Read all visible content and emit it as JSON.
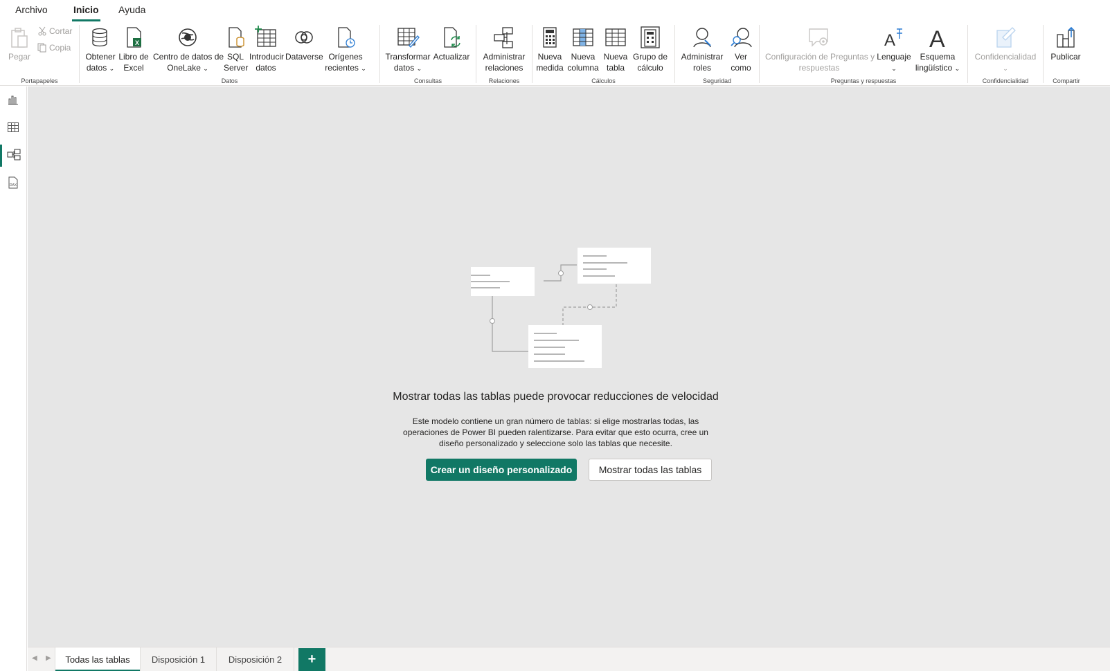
{
  "menu": {
    "tabs": [
      "Archivo",
      "Inicio",
      "Ayuda"
    ],
    "active": "Inicio"
  },
  "ribbon": {
    "clipboard": {
      "paste": "Pegar",
      "cut": "Cortar",
      "copy": "Copia",
      "label": "Portapapeles"
    },
    "data": {
      "label": "Datos",
      "get_data": "Obtener",
      "get_data2": "datos",
      "excel": "Libro de",
      "excel2": "Excel",
      "onelake": "Centro de datos de",
      "onelake2": "OneLake",
      "sql": "SQL",
      "sql2": "Server",
      "enter": "Introducir",
      "enter2": "datos",
      "dataverse": "Dataverse",
      "recent": "Orígenes",
      "recent2": "recientes"
    },
    "queries": {
      "label": "Consultas",
      "transform": "Transformar",
      "transform2": "datos",
      "refresh": "Actualizar"
    },
    "relations": {
      "label": "Relaciones",
      "manage": "Administrar",
      "manage2": "relaciones"
    },
    "calcs": {
      "label": "Cálculos",
      "measure": "Nueva",
      "measure2": "medida",
      "column": "Nueva",
      "column2": "columna",
      "table": "Nueva",
      "table2": "tabla",
      "group": "Grupo de",
      "group2": "cálculo"
    },
    "security": {
      "label": "Seguridad",
      "roles": "Administrar",
      "roles2": "roles",
      "view": "Ver",
      "view2": "como"
    },
    "qa": {
      "label": "Preguntas y respuestas",
      "setup": "Configuración de Preguntas y",
      "setup2": "respuestas",
      "language": "Lenguaje",
      "schema": "Esquema",
      "schema2": "lingüístico"
    },
    "sensitivity": {
      "label": "Confidencialidad",
      "btn": "Confidencialidad"
    },
    "share": {
      "label": "Compartir",
      "publish": "Publicar"
    }
  },
  "canvas": {
    "title": "Mostrar todas las tablas puede provocar reducciones de velocidad",
    "body": "Este modelo contiene un gran número de tablas: si elige mostrarlas todas, las operaciones de Power BI pueden ralentizarse. Para evitar que esto ocurra, cree un diseño personalizado y seleccione solo las tablas que necesite.",
    "primary_button": "Crear un diseño personalizado",
    "secondary_button": "Mostrar todas las tablas"
  },
  "bottom_tabs": [
    "Todas las tablas",
    "Disposición 1",
    "Disposición 2"
  ],
  "add_tab": "+",
  "colors": {
    "accent": "#117865",
    "canvas_bg": "#e6e6e6",
    "disabled": "#a19f9d"
  }
}
